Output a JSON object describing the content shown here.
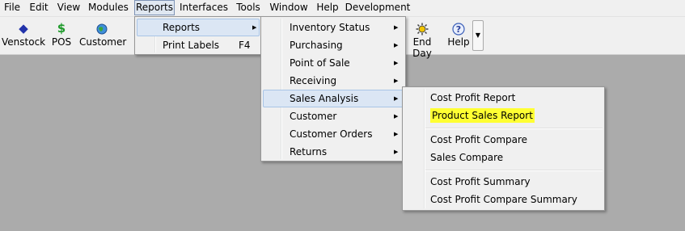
{
  "menubar": {
    "items": [
      "File",
      "Edit",
      "View",
      "Modules",
      "Reports",
      "Interfaces",
      "Tools",
      "Window",
      "Help",
      "Development"
    ]
  },
  "toolbar": {
    "venstock": {
      "label": "Venstock",
      "icon": "venstock-icon"
    },
    "pos": {
      "label": "POS",
      "icon": "dollar-icon"
    },
    "customer": {
      "label": "Customer",
      "icon": "customer-globe-icon"
    },
    "endday": {
      "label": "End Day",
      "icon": "sun-icon"
    },
    "help": {
      "label": "Help",
      "icon": "question-icon"
    }
  },
  "reports_menu": {
    "items": [
      {
        "label": "Reports",
        "shortcut": ""
      },
      {
        "label": "Print Labels",
        "shortcut": "F4"
      }
    ]
  },
  "reports_submenu": {
    "items": [
      "Inventory Status",
      "Purchasing",
      "Point of Sale",
      "Receiving",
      "Sales Analysis",
      "Customer",
      "Customer Orders",
      "Returns"
    ]
  },
  "sales_analysis_submenu": {
    "group1": [
      "Cost Profit Report",
      "Product Sales Report"
    ],
    "group2": [
      "Cost Profit Compare",
      "Sales Compare"
    ],
    "group3": [
      "Cost Profit Summary",
      "Cost Profit Compare Summary"
    ]
  },
  "colors": {
    "highlighter": "#ffff33",
    "menu_highlight": "#dbe6f4",
    "workspace": "#ababab"
  }
}
